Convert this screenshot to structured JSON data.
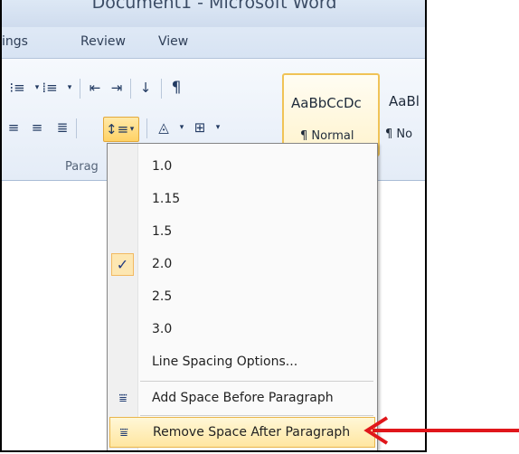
{
  "window": {
    "title": "Document1 - Microsoft Word"
  },
  "tabs": [
    "ings",
    "Review",
    "View"
  ],
  "ribbon": {
    "group_label": "Parag",
    "styles": [
      {
        "sample": "AaBbCcDc",
        "name": "¶ Normal"
      },
      {
        "sample": "AaBl",
        "name": "¶ No"
      }
    ]
  },
  "line_spacing_menu": {
    "options": [
      "1.0",
      "1.15",
      "1.5",
      "2.0",
      "2.5",
      "3.0"
    ],
    "selected": "2.0",
    "line_spacing_options": "Line Spacing Options...",
    "add_space_before": "Add Space Before Paragraph",
    "remove_space_after": "Remove Space After Paragraph"
  },
  "colors": {
    "arrow": "#e0161b",
    "highlight_border": "#e9b54b"
  },
  "icons": {
    "checkmark": "check-icon",
    "add_space": "add-space-before-icon",
    "remove_space": "remove-space-after-icon"
  }
}
